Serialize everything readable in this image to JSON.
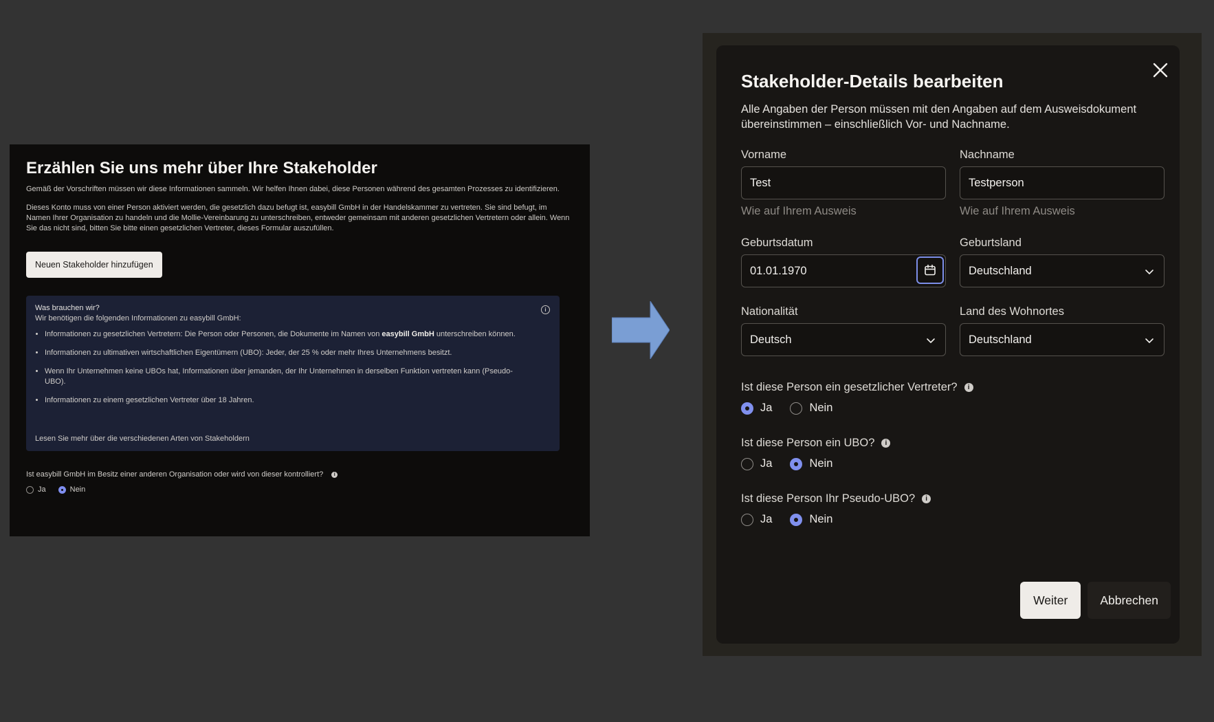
{
  "left": {
    "title": "Erzählen Sie uns mehr über Ihre Stakeholder",
    "para1": "Gemäß der Vorschriften müssen wir diese Informationen sammeln. Wir helfen Ihnen dabei, diese Personen während des gesamten Prozesses zu identifizieren.",
    "para2": "Dieses Konto muss von einer Person aktiviert werden, die gesetzlich dazu befugt ist, easybill GmbH in der Handelskammer zu vertreten. Sie sind befugt, im Namen Ihrer Organisation zu handeln und die Mollie-Vereinbarung zu unterschreiben, entweder gemeinsam mit anderen gesetzlichen Vertretern oder allein. Wenn Sie das nicht sind, bitten Sie bitte einen gesetzlichen Vertreter, dieses Formular auszufüllen.",
    "add_button": "Neuen Stakeholder hinzufügen",
    "info": {
      "title": "Was brauchen wir?",
      "intro": "Wir benötigen die folgenden Informationen zu easybill GmbH:",
      "item1_pre": "Informationen zu gesetzlichen Vertretern: Die Person oder Personen, die Dokumente im Namen von ",
      "item1_bold": "easybill GmbH",
      "item1_post": " unterschreiben können.",
      "item2": "Informationen zu ultimativen wirtschaftlichen Eigentümern (UBO): Jeder, der 25 % oder mehr Ihres Unternehmens besitzt.",
      "item3": "Wenn Ihr Unternehmen keine UBOs hat, Informationen über jemanden, der Ihr Unternehmen in derselben Funktion vertreten kann (Pseudo-UBO).",
      "item4": "Informationen zu einem gesetzlichen Vertreter über 18 Jahren.",
      "link": "Lesen Sie mehr über die verschiedenen Arten von Stakeholdern"
    },
    "question": "Ist easybill GmbH im Besitz einer anderen Organisation oder wird von dieser kontrolliert?",
    "yes": "Ja",
    "no": "Nein",
    "selected": "Nein"
  },
  "modal": {
    "title": "Stakeholder-Details bearbeiten",
    "description": "Alle Angaben der Person müssen mit den Angaben auf dem Ausweisdokument übereinstimmen – einschließlich Vor- und Nachname.",
    "firstname_label": "Vorname",
    "firstname_value": "Test",
    "lastname_label": "Nachname",
    "lastname_value": "Testperson",
    "id_hint": "Wie auf Ihrem Ausweis",
    "birthdate_label": "Geburtsdatum",
    "birthdate_value": "01.01.1970",
    "birthcountry_label": "Geburtsland",
    "birthcountry_value": "Deutschland",
    "nationality_label": "Nationalität",
    "nationality_value": "Deutsch",
    "residence_label": "Land des Wohnortes",
    "residence_value": "Deutschland",
    "q_legal": "Ist diese Person ein gesetzlicher Vertreter?",
    "q_ubo": "Ist diese Person ein UBO?",
    "q_pseudo": "Ist diese Person Ihr Pseudo-UBO?",
    "yes": "Ja",
    "no": "Nein",
    "answers": {
      "legal": "Ja",
      "ubo": "Nein",
      "pseudo": "Nein"
    },
    "next_button": "Weiter",
    "cancel_button": "Abbrechen"
  },
  "colors": {
    "accent": "#8090ee",
    "arrow": "#7a9ed4",
    "background": "#333333"
  },
  "icons": [
    "info-icon",
    "arrow-right-icon",
    "close-icon",
    "calendar-icon",
    "chevron-down-icon"
  ]
}
